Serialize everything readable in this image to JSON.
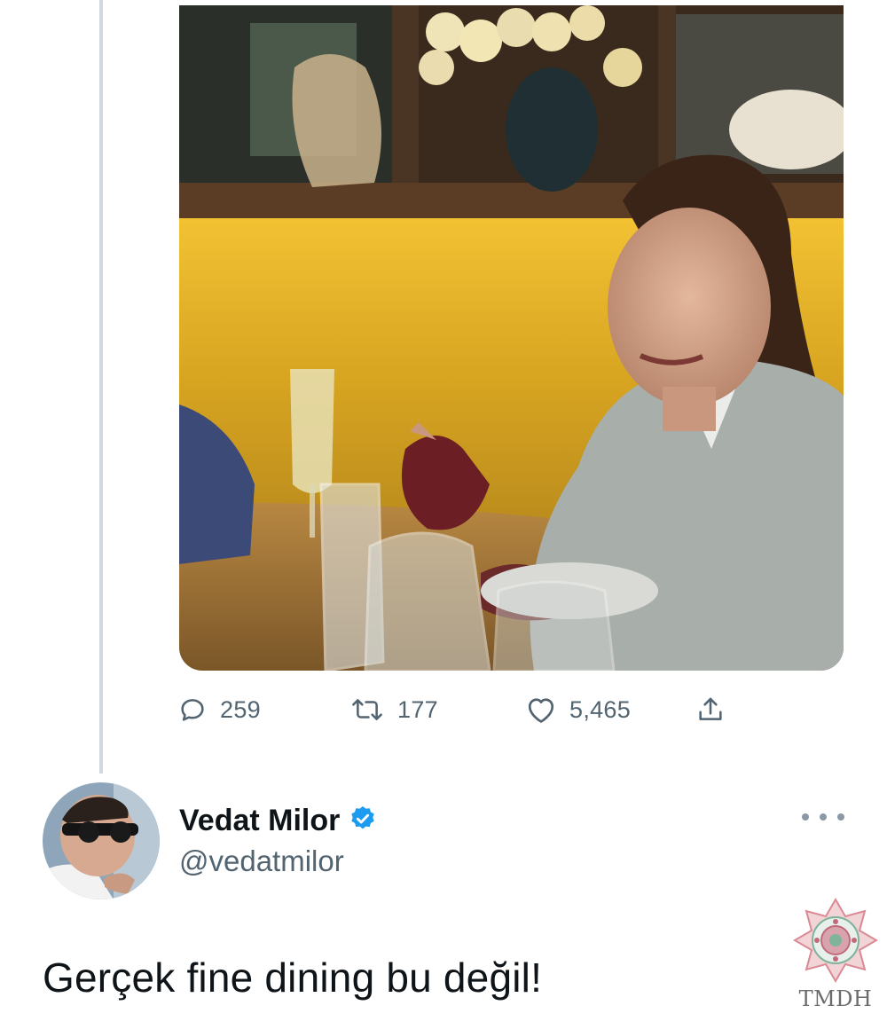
{
  "tweet": {
    "stats": {
      "replies": "259",
      "retweets": "177",
      "likes": "5,465"
    }
  },
  "reply": {
    "author": {
      "name": "Vedat Milor",
      "handle": "@vedatmilor",
      "verified": true
    },
    "text": "Gerçek fine dining bu değil!"
  },
  "watermark": {
    "text": "TMDH"
  },
  "icons": {
    "reply": "comment-icon",
    "retweet": "retweet-icon",
    "like": "heart-icon",
    "share": "share-icon",
    "verified": "verified-badge-icon",
    "more": "more-options-icon"
  },
  "colors": {
    "icon_gray": "#536471",
    "verified_blue": "#1d9bf0",
    "thread_line": "#cfd9de"
  }
}
